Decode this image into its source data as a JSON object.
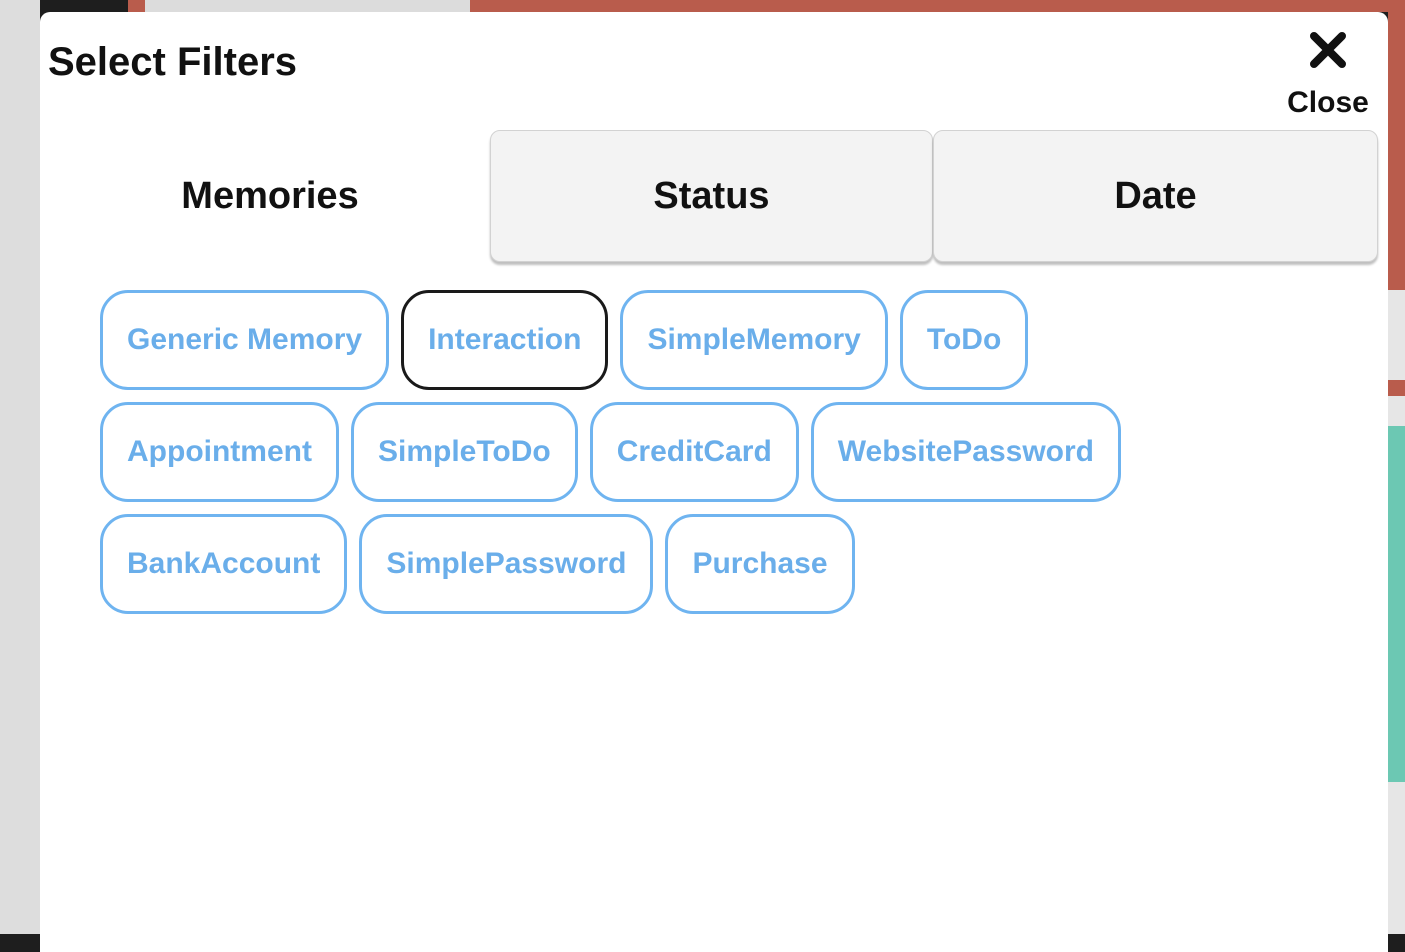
{
  "dialog": {
    "title": "Select Filters",
    "close_label": "Close",
    "close_icon": "close-x-icon"
  },
  "tabs": [
    {
      "label": "Memories",
      "active": true
    },
    {
      "label": "Status",
      "active": false
    },
    {
      "label": "Date",
      "active": false
    }
  ],
  "filters": {
    "rows": [
      [
        {
          "label": "Generic Memory",
          "selected": false
        },
        {
          "label": "Interaction",
          "selected": true
        },
        {
          "label": "SimpleMemory",
          "selected": false
        },
        {
          "label": "ToDo",
          "selected": false
        }
      ],
      [
        {
          "label": "Appointment",
          "selected": false
        },
        {
          "label": "SimpleToDo",
          "selected": false
        },
        {
          "label": "CreditCard",
          "selected": false
        },
        {
          "label": "WebsitePassword",
          "selected": false
        }
      ],
      [
        {
          "label": "BankAccount",
          "selected": false
        },
        {
          "label": "SimplePassword",
          "selected": false
        },
        {
          "label": "Purchase",
          "selected": false
        }
      ]
    ]
  },
  "colors": {
    "chip_border": "#6fb4f0",
    "chip_text": "#6aaeea",
    "selected_border": "#1a1a1a",
    "background_accent_red": "#b95c4c",
    "background_accent_teal": "#6cc8b3"
  }
}
